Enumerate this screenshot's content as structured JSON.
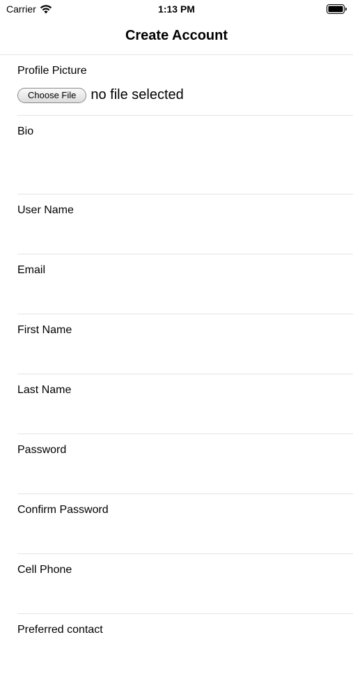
{
  "status_bar": {
    "carrier": "Carrier",
    "time": "1:13 PM"
  },
  "nav": {
    "title": "Create Account"
  },
  "profile_picture": {
    "label": "Profile Picture",
    "button_label": "Choose File",
    "file_status": "no file selected"
  },
  "fields": {
    "bio": "Bio",
    "user_name": "User Name",
    "email": "Email",
    "first_name": "First Name",
    "last_name": "Last Name",
    "password": "Password",
    "confirm_password": "Confirm Password",
    "cell_phone": "Cell Phone",
    "preferred_contact": "Preferred contact"
  },
  "colors": {
    "separator": "#e4e4e4",
    "text": "#000000",
    "background": "#ffffff"
  }
}
